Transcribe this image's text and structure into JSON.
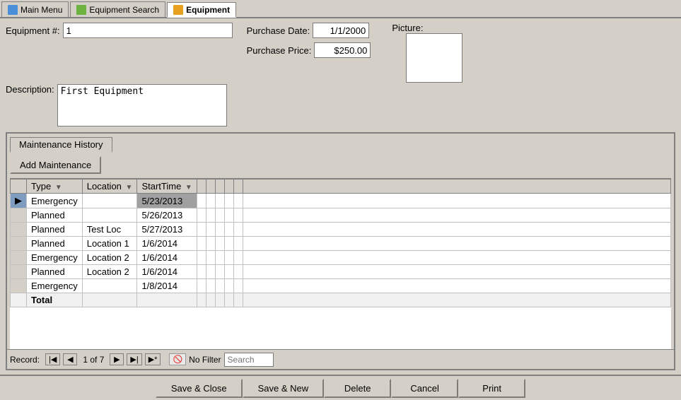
{
  "tabs": [
    {
      "id": "main-menu",
      "label": "Main Menu",
      "icon": "main-icon",
      "active": false
    },
    {
      "id": "equipment-search",
      "label": "Equipment Search",
      "icon": "search-icon",
      "active": false
    },
    {
      "id": "equipment",
      "label": "Equipment",
      "icon": "equip-icon",
      "active": true
    }
  ],
  "form": {
    "equipment_num_label": "Equipment #:",
    "equipment_num_value": "1",
    "description_label": "Description:",
    "description_value": "First Equipment",
    "purchase_date_label": "Purchase Date:",
    "purchase_date_value": "1/1/2000",
    "purchase_price_label": "Purchase Price:",
    "purchase_price_value": "$250.00",
    "picture_label": "Picture:"
  },
  "panel": {
    "tab_label": "Maintenance History",
    "add_btn_label": "Add Maintenance"
  },
  "table": {
    "columns": [
      {
        "id": "selector",
        "label": ""
      },
      {
        "id": "type",
        "label": "Type",
        "sortable": true
      },
      {
        "id": "location",
        "label": "Location",
        "sortable": true
      },
      {
        "id": "starttime",
        "label": "StartTime",
        "sortable": true
      }
    ],
    "rows": [
      {
        "selector": "▶",
        "type": "Emergency",
        "location": "",
        "starttime": "5/23/2013",
        "active": true
      },
      {
        "selector": "",
        "type": "Planned",
        "location": "",
        "starttime": "5/26/2013",
        "active": false
      },
      {
        "selector": "",
        "type": "Planned",
        "location": "Test Loc",
        "starttime": "5/27/2013",
        "active": false
      },
      {
        "selector": "",
        "type": "Planned",
        "location": "Location 1",
        "starttime": "1/6/2014",
        "active": false
      },
      {
        "selector": "",
        "type": "Emergency",
        "location": "Location 2",
        "starttime": "1/6/2014",
        "active": false
      },
      {
        "selector": "",
        "type": "Planned",
        "location": "Location 2",
        "starttime": "1/6/2014",
        "active": false
      },
      {
        "selector": "",
        "type": "Emergency",
        "location": "",
        "starttime": "1/8/2014",
        "active": false
      }
    ],
    "total_row": {
      "label": "Total",
      "type": "",
      "location": "",
      "starttime": ""
    }
  },
  "nav": {
    "record_label": "Record:",
    "current": "1 of 7",
    "first_btn": "⏮",
    "prev_btn": "◀",
    "next_btn": "▶",
    "last_btn": "⏭",
    "new_btn": "▶*",
    "no_filter_label": "No Filter",
    "search_placeholder": "Search"
  },
  "bottom_buttons": [
    {
      "id": "save-close",
      "label": "Save & Close"
    },
    {
      "id": "save-new",
      "label": "Save & New"
    },
    {
      "id": "delete",
      "label": "Delete"
    },
    {
      "id": "cancel",
      "label": "Cancel"
    },
    {
      "id": "print",
      "label": "Print"
    }
  ]
}
